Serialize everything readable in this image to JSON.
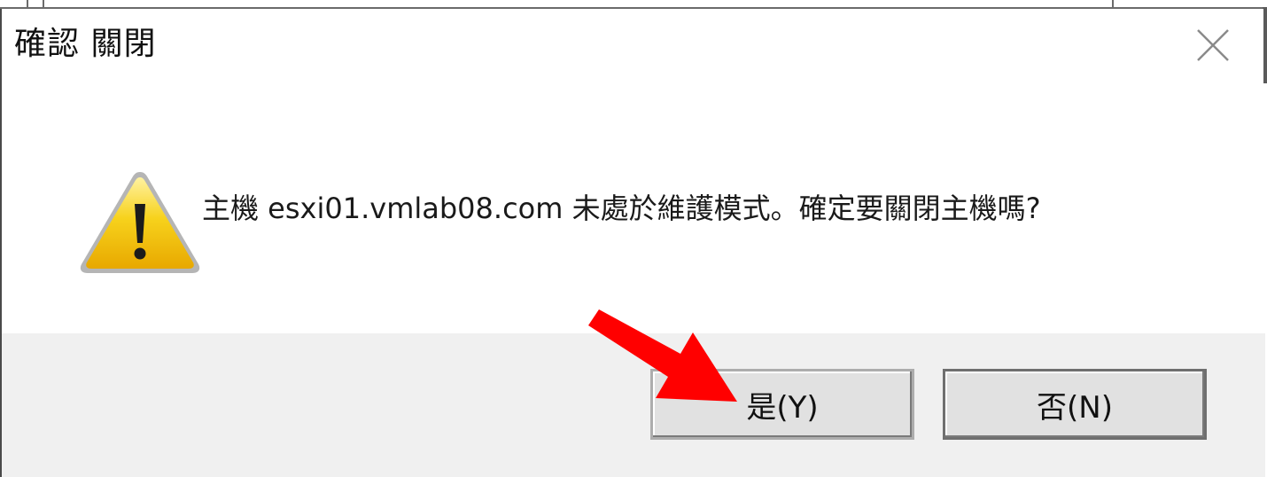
{
  "dialog": {
    "title": "確認 關閉",
    "message": "主機 esxi01.vmlab08.com 未處於維護模式。確定要關閉主機嗎?",
    "buttons": {
      "yes_label": "是(Y)",
      "no_label": "否(N)"
    }
  },
  "icons": {
    "warning": "warning-triangle-icon",
    "close": "close-icon",
    "annotation": "red-arrow-icon"
  },
  "colors": {
    "annotation_arrow": "#ff0000",
    "warning_fill": "#f5c800",
    "footer_background": "#f0f0f0"
  }
}
